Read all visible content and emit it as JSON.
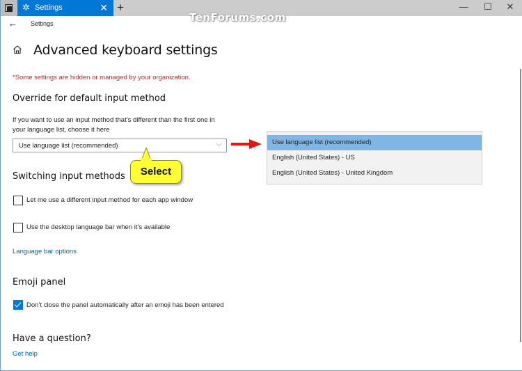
{
  "window": {
    "tab_title": "Settings",
    "tab_icon": "gear-icon",
    "new_tab_label": "+",
    "tab_close_label": "✕",
    "minimize_label": "—",
    "maximize_label": "☐",
    "close_label": "✕",
    "watermark": "TenForums.com"
  },
  "header": {
    "back_label": "←",
    "app_title": "Settings"
  },
  "page": {
    "title": "Advanced keyboard settings",
    "warning": "*Some settings are hidden or managed by your organization."
  },
  "override": {
    "heading": "Override for default input method",
    "description": "If you want to use an input method that’s different than the first one in your language list, choose it here",
    "selected_value": "Use language list (recommended)",
    "options": [
      {
        "label": "Use language list (recommended)",
        "selected": true
      },
      {
        "label": "English (United States) - US",
        "selected": false
      },
      {
        "label": "English (United States) - United Kingdom",
        "selected": false
      }
    ]
  },
  "annotation": {
    "callout_text": "Select",
    "arrow_color": "#e3151b",
    "callout_color": "#ffff33"
  },
  "switching": {
    "heading": "Switching input methods",
    "checkboxes": [
      {
        "label": "Let me use a different input method for each app window",
        "checked": false
      },
      {
        "label": "Use the desktop language bar when it’s available",
        "checked": false
      }
    ],
    "link": "Language bar options"
  },
  "emoji": {
    "heading": "Emoji panel",
    "checkbox": {
      "label": "Don’t close the panel automatically after an emoji has been entered",
      "checked": true
    }
  },
  "help": {
    "heading": "Have a question?",
    "link": "Get help"
  },
  "colors": {
    "accent": "#0078d7",
    "link": "#0063b1",
    "warning": "#c4272c",
    "dropdown_selected": "#7fb6e6"
  }
}
